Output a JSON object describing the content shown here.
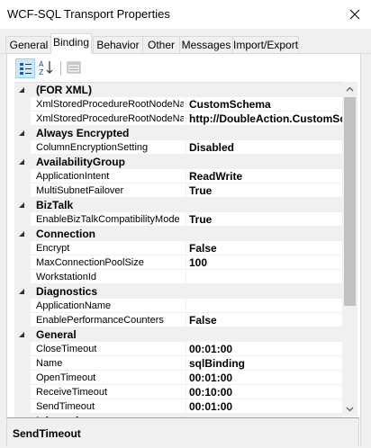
{
  "window": {
    "title": "WCF-SQL Transport Properties",
    "close_icon": "close-icon"
  },
  "tabs": [
    {
      "label": "General"
    },
    {
      "label": "Binding",
      "active": true
    },
    {
      "label": "Behavior"
    },
    {
      "label": "Other"
    },
    {
      "label": "Messages"
    },
    {
      "label": "Import/Export"
    }
  ],
  "toolbar": {
    "categorized_icon": "categorized-view-icon",
    "alphabetical_icon": "alphabetical-sort-icon",
    "pages_icon": "property-pages-icon"
  },
  "grid": {
    "rows": [
      {
        "type": "category",
        "label": "(FOR XML)"
      },
      {
        "type": "prop",
        "name": "XmlStoredProcedureRootNodeName",
        "value": "CustomSchema"
      },
      {
        "type": "prop",
        "name": "XmlStoredProcedureRootNodeNamespace",
        "value": "http://DoubleAction.CustomSchema"
      },
      {
        "type": "category",
        "label": "Always Encrypted"
      },
      {
        "type": "prop",
        "name": "ColumnEncryptionSetting",
        "value": "Disabled"
      },
      {
        "type": "category",
        "label": "AvailabilityGroup"
      },
      {
        "type": "prop",
        "name": "ApplicationIntent",
        "value": "ReadWrite"
      },
      {
        "type": "prop",
        "name": "MultiSubnetFailover",
        "value": "True"
      },
      {
        "type": "category",
        "label": "BizTalk"
      },
      {
        "type": "prop",
        "name": "EnableBizTalkCompatibilityMode",
        "value": "True"
      },
      {
        "type": "category",
        "label": "Connection"
      },
      {
        "type": "prop",
        "name": "Encrypt",
        "value": "False"
      },
      {
        "type": "prop",
        "name": "MaxConnectionPoolSize",
        "value": "100"
      },
      {
        "type": "prop",
        "name": "WorkstationId",
        "value": ""
      },
      {
        "type": "category",
        "label": "Diagnostics"
      },
      {
        "type": "prop",
        "name": "ApplicationName",
        "value": ""
      },
      {
        "type": "prop",
        "name": "EnablePerformanceCounters",
        "value": "False"
      },
      {
        "type": "category",
        "label": "General"
      },
      {
        "type": "prop",
        "name": "CloseTimeout",
        "value": "00:01:00"
      },
      {
        "type": "prop",
        "name": "Name",
        "value": "sqlBinding"
      },
      {
        "type": "prop",
        "name": "OpenTimeout",
        "value": "00:01:00"
      },
      {
        "type": "prop",
        "name": "ReceiveTimeout",
        "value": "00:10:00"
      },
      {
        "type": "prop",
        "name": "SendTimeout",
        "value": "00:01:00"
      },
      {
        "type": "category",
        "label": "Inbound"
      }
    ]
  },
  "description": {
    "title": "SendTimeout"
  },
  "colors": {
    "window_bg": "#f0f0f0",
    "grid_line": "#f0f0f0",
    "selected_toolbar": "#cce8ff",
    "scroll_thumb": "#c1c1c1"
  }
}
